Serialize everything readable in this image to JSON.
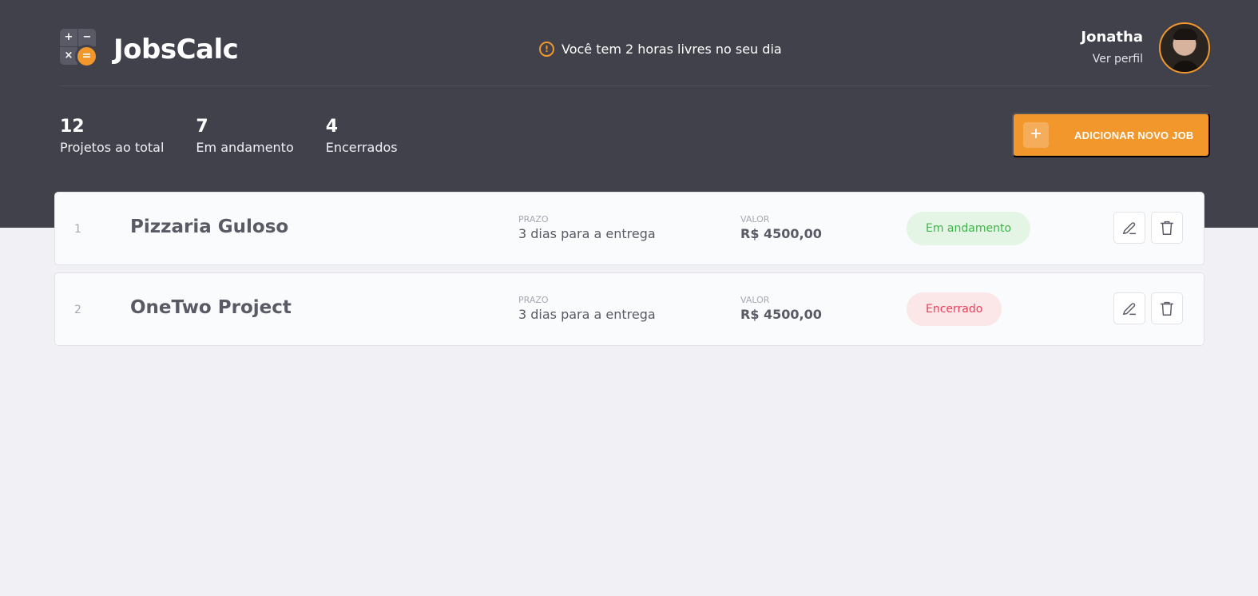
{
  "app": {
    "brand": "JobsCalc",
    "notice": "Você tem 2 horas livres no seu dia",
    "user": {
      "name": "Jonatha",
      "profile_link": "Ver perfil"
    }
  },
  "summary": [
    {
      "value": "12",
      "label": "Projetos ao total"
    },
    {
      "value": "7",
      "label": "Em andamento"
    },
    {
      "value": "4",
      "label": "Encerrados"
    }
  ],
  "actions": {
    "add_job": "ADICIONAR NOVO JOB"
  },
  "jobs": [
    {
      "id": "1",
      "name": "Pizzaria Guloso",
      "deadline_label": "PRAZO",
      "deadline": "3 dias para a entrega",
      "value_label": "VALOR",
      "value": "R$ 4500,00",
      "status": "Em andamento",
      "status_color": "#3FB44A"
    },
    {
      "id": "2",
      "name": "OneTwo Project",
      "deadline_label": "PRAZO",
      "deadline": "3 dias para a entrega",
      "value_label": "VALOR",
      "value": "R$ 4500,00",
      "status": "Encerrado",
      "status_color": "#E83F5B"
    }
  ],
  "icons": {
    "logo": "calculator-logo-icon",
    "notice": "alert-icon",
    "add": "plus-icon",
    "edit": "pencil-icon",
    "delete": "trash-icon"
  },
  "colors": {
    "accent": "#F1972C",
    "header": "#41414C",
    "background": "#F0F0F5"
  }
}
